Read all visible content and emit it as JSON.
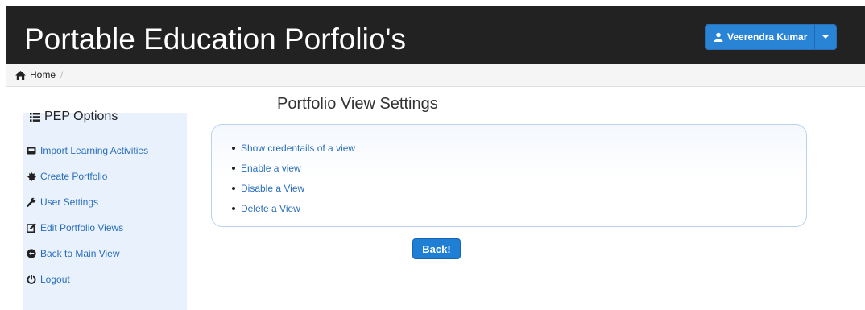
{
  "header": {
    "title": "Portable Education Porfolio's",
    "user_name": "Veerendra Kumar"
  },
  "breadcrumb": {
    "home_label": "Home",
    "separator": "/"
  },
  "sidebar": {
    "heading": "PEP Options",
    "items": [
      {
        "label": "Import Learning Activities",
        "icon": "hdd-icon"
      },
      {
        "label": "Create Portfolio",
        "icon": "certificate-icon"
      },
      {
        "label": "User Settings",
        "icon": "wrench-icon"
      },
      {
        "label": "Edit Portfolio Views",
        "icon": "edit-icon"
      },
      {
        "label": "Back to Main View",
        "icon": "circle-arrow-left-icon"
      },
      {
        "label": "Logout",
        "icon": "off-icon"
      }
    ]
  },
  "main": {
    "title": "Portfolio View Settings",
    "links": [
      "Show credentails of a view",
      "Enable a view",
      "Disable a View",
      "Delete a View"
    ],
    "back_label": "Back!"
  },
  "colors": {
    "header_bg": "#222222",
    "link": "#2a6ebb",
    "primary_button": "#1f7fd4",
    "sidebar_bg": "#e8f1fc"
  }
}
